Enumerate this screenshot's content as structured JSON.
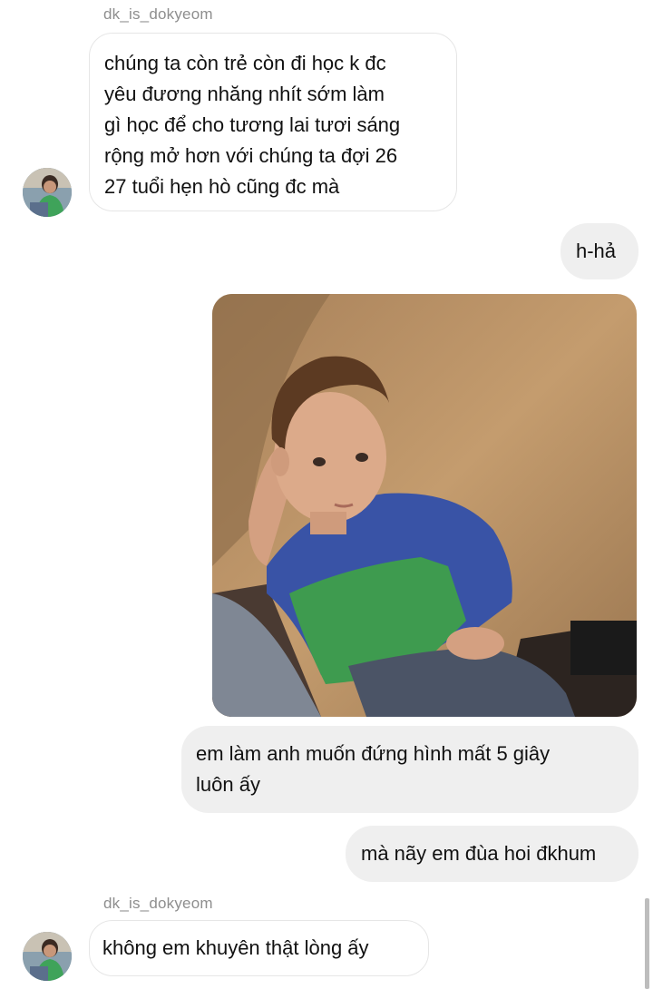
{
  "conversation": {
    "messages": [
      {
        "direction": "incoming",
        "sender": "dk_is_dokyeom",
        "text_lines": [
          "chúng ta còn trẻ còn đi học k đc",
          "yêu đương nhăng nhít sớm làm",
          "gì học để cho tương lai tươi sáng",
          "rộng mở hơn với chúng ta đợi 26",
          "27 tuổi hẹn hò cũng đc mà"
        ]
      },
      {
        "direction": "outgoing",
        "text": "h-hả"
      },
      {
        "direction": "outgoing",
        "image": "boy-in-blue-green-shirt-photo"
      },
      {
        "direction": "outgoing",
        "text_lines": [
          "em làm anh muốn đứng hình mất 5 giây",
          "luôn ấy"
        ]
      },
      {
        "direction": "outgoing",
        "text": "mà nãy em đùa hoi đkhum"
      },
      {
        "direction": "incoming",
        "sender": "dk_is_dokyeom",
        "text": "không em khuyên thật lòng ấy"
      }
    ]
  },
  "theme": {
    "incoming_bubble": "#ffffff",
    "outgoing_bubble": "#efefef",
    "sender_name_color": "#8e8e8e"
  },
  "icons": {
    "avatar": "user-avatar-photo"
  }
}
